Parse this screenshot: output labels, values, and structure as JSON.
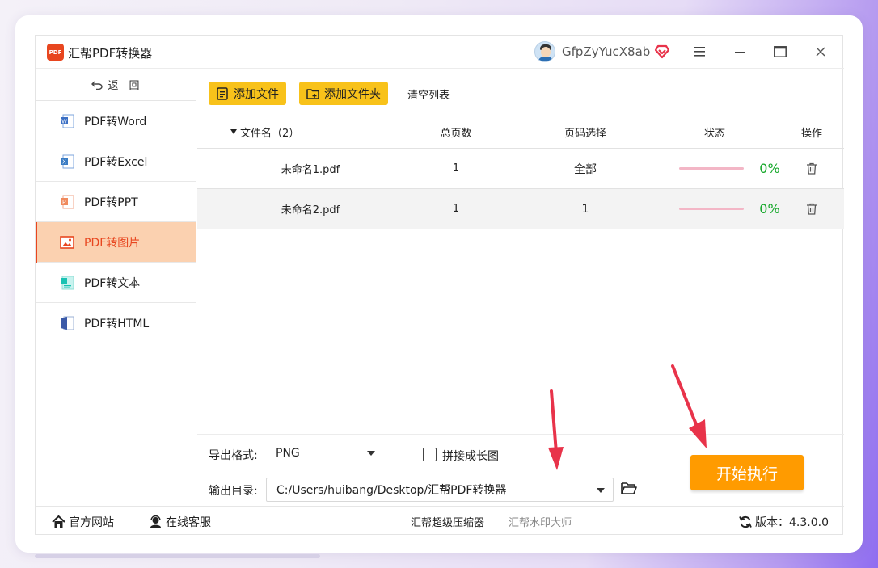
{
  "app": {
    "title": "汇帮PDF转换器",
    "logo_text": "PDF",
    "username": "GfpZyYucX8ab"
  },
  "sidebar": {
    "back_label": "返　回",
    "items": [
      {
        "label": "PDF转Word",
        "icon": "word-icon"
      },
      {
        "label": "PDF转Excel",
        "icon": "excel-icon"
      },
      {
        "label": "PDF转PPT",
        "icon": "ppt-icon"
      },
      {
        "label": "PDF转图片",
        "icon": "image-icon",
        "active": true
      },
      {
        "label": "PDF转文本",
        "icon": "text-icon"
      },
      {
        "label": "PDF转HTML",
        "icon": "html-icon"
      }
    ]
  },
  "toolbar": {
    "add_file": "添加文件",
    "add_folder": "添加文件夹",
    "clear_list": "清空列表"
  },
  "table": {
    "headers": {
      "filename": "文件名（2）",
      "pages": "总页数",
      "page_select": "页码选择",
      "status": "状态",
      "action": "操作"
    },
    "rows": [
      {
        "filename": "未命名1.pdf",
        "pages": "1",
        "page_select": "全部",
        "progress": "0%"
      },
      {
        "filename": "未命名2.pdf",
        "pages": "1",
        "page_select": "1",
        "progress": "0%"
      }
    ]
  },
  "settings": {
    "format_label": "导出格式:",
    "format_value": "PNG",
    "merge_label": "拼接成长图",
    "dir_label": "输出目录:",
    "dir_value": "C:/Users/huibang/Desktop/汇帮PDF转换器",
    "start_label": "开始执行"
  },
  "footer": {
    "website": "官方网站",
    "support": "在线客服",
    "link1": "汇帮超级压缩器",
    "link2": "汇帮水印大师",
    "version": "版本：4.3.0.0"
  },
  "colors": {
    "accent": "#e8461f",
    "button_yellow": "#f8c21a",
    "start_orange": "#ff9b00",
    "progress_green": "#15a82a",
    "annotation_red": "#e8334a"
  }
}
